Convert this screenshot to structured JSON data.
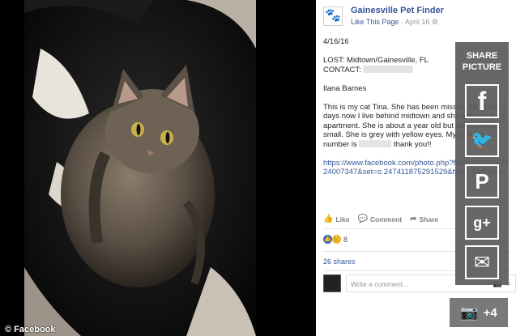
{
  "photo": {
    "credit": "© Facebook"
  },
  "post": {
    "page_name": "Gainesville Pet Finder",
    "like_page": "Like This Page",
    "meta_sep": " · ",
    "date": "April 16",
    "globe": "⚙",
    "lines": {
      "date_line": "4/16/16",
      "lost_line": "LOST: Midtown/Gainesville, FL",
      "contact_label": "CONTACT:",
      "name_line": "Ilana Barnes",
      "story_part1": "This is my cat Tina. She has been missing for about 4 days now I live behind midtown and she got out of my apartment. She is about a year old but she's pretty small. She is grey with yellow eyes. My contact number is",
      "story_part2": "thank you!!",
      "link": "https://www.facebook.com/photo.php?fbid=10206064824007347&set=o.247411875291529&type=3&theater"
    },
    "actions": {
      "like": "Like",
      "comment": "Comment",
      "share": "Share"
    },
    "reactions": {
      "count": "8"
    },
    "shares": "26 shares",
    "comment_placeholder": "Write a comment..."
  },
  "share_panel": {
    "title": "SHARE PICTURE",
    "icons": [
      "facebook-icon",
      "twitter-icon",
      "pinterest-icon",
      "google-plus-icon",
      "email-icon"
    ]
  },
  "more_photos": {
    "label": "+4"
  },
  "colors": {
    "link_blue": "#365899",
    "panel_gray": "#5a5a5a",
    "like_blue": "#4267b2"
  }
}
